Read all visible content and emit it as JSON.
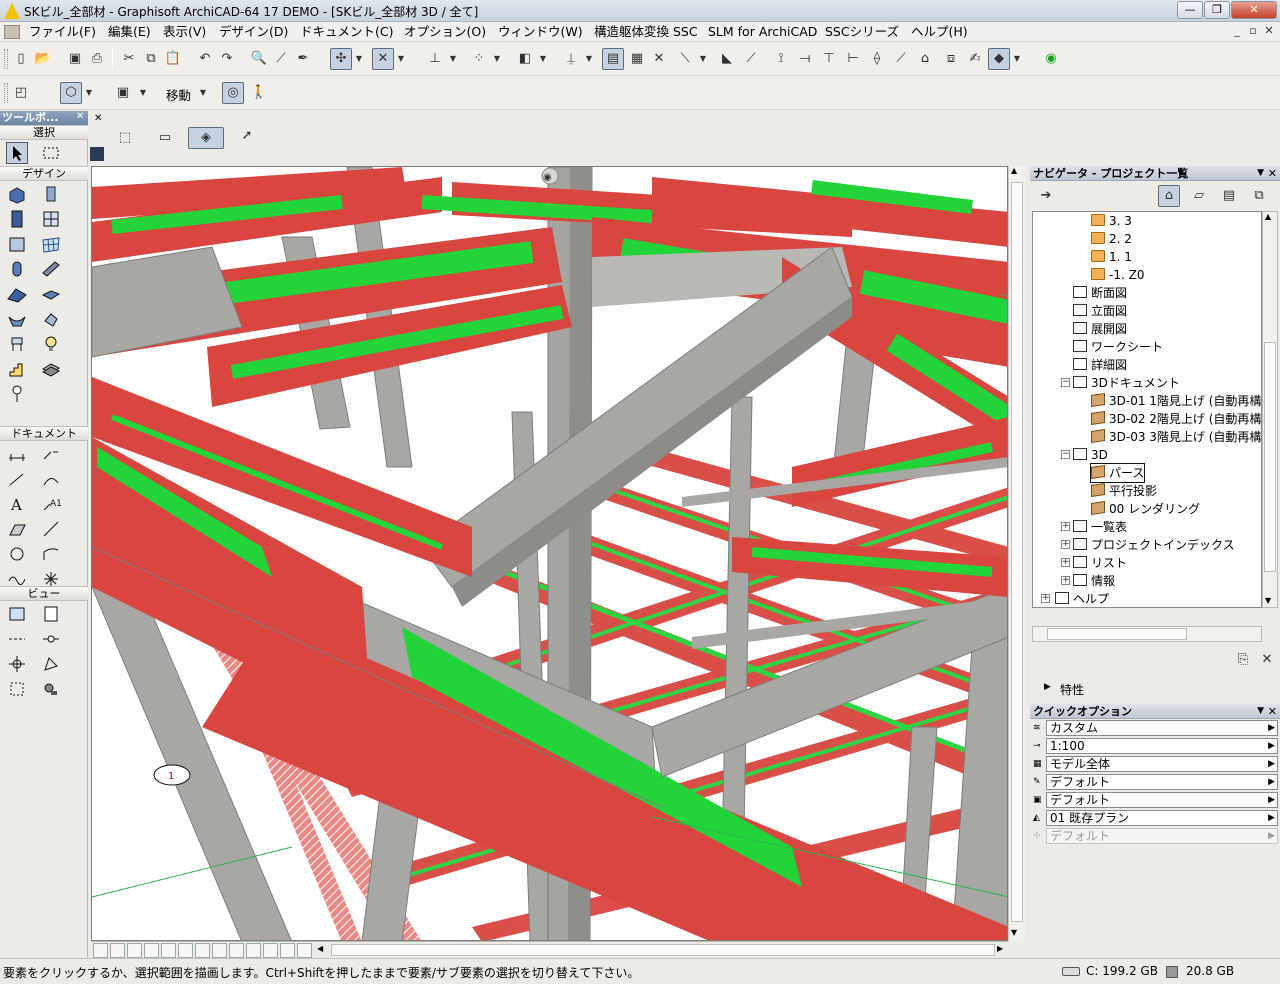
{
  "window": {
    "title": "SKビル_全部材 - Graphisoft ArchiCAD-64 17 DEMO - [SKビル_全部材 3D / 全て]",
    "minimize": "—",
    "maximize": "❐",
    "close": "✕"
  },
  "menu": {
    "items": [
      "ファイル(F)",
      "編集(E)",
      "表示(V)",
      "デザイン(D)",
      "ドキュメント(C)",
      "オプション(O)",
      "ウィンドウ(W)",
      "構造躯体変換 SSC",
      "SLM for ArchiCAD",
      "SSCシリーズ",
      "ヘルプ(H)"
    ]
  },
  "toolbar2": {
    "move_label": "移動"
  },
  "toolbox": {
    "title": "ツールボ...",
    "sections": {
      "select": "選択",
      "design": "デザイン",
      "document": "ドキュメント",
      "view": "ビュー"
    }
  },
  "navigator": {
    "title": "ナビゲータ - プロジェクト一覧",
    "tree": [
      {
        "label": "3. 3",
        "icon": "story-icon"
      },
      {
        "label": "2. 2",
        "icon": "story-icon"
      },
      {
        "label": "1. 1",
        "icon": "story-icon"
      },
      {
        "label": "-1. Z0",
        "icon": "story-icon"
      },
      {
        "label": "断面図",
        "icon": "section-icon"
      },
      {
        "label": "立面図",
        "icon": "elevation-icon"
      },
      {
        "label": "展開図",
        "icon": "interior-elevation-icon"
      },
      {
        "label": "ワークシート",
        "icon": "worksheet-icon"
      },
      {
        "label": "詳細図",
        "icon": "detail-icon"
      },
      {
        "label": "3Dドキュメント",
        "icon": "3d-document-icon"
      },
      {
        "label": "3D-01 1階見上げ (自動再構",
        "icon": "3d-doc-item-icon"
      },
      {
        "label": "3D-02 2階見上げ (自動再構",
        "icon": "3d-doc-item-icon"
      },
      {
        "label": "3D-03 3階見上げ (自動再構",
        "icon": "3d-doc-item-icon"
      },
      {
        "label": "3D",
        "icon": "3d-icon"
      },
      {
        "label": "パース",
        "icon": "camera-icon"
      },
      {
        "label": "平行投影",
        "icon": "axon-icon"
      },
      {
        "label": "00 レンダリング",
        "icon": "render-icon"
      },
      {
        "label": "一覧表",
        "icon": "schedule-icon"
      },
      {
        "label": "プロジェクトインデックス",
        "icon": "index-icon"
      },
      {
        "label": "リスト",
        "icon": "list-icon"
      },
      {
        "label": "情報",
        "icon": "info-icon"
      },
      {
        "label": "ヘルプ",
        "icon": "help-icon"
      }
    ],
    "properties_label": "特性"
  },
  "quick_options": {
    "title": "クイックオプション",
    "rows": [
      "カスタム",
      "1:100",
      "モデル全体",
      "デフォルト",
      "デフォルト",
      "01 既存プラン",
      "デフォルト"
    ]
  },
  "status": {
    "message": "要素をクリックするか、選択範囲を描画します。Ctrl+Shiftを押したままで要素/サブ要素の選択を切り替えて下さい。",
    "disk_c": "C: 199.2 GB",
    "disk_other": "20.8 GB"
  },
  "colors": {
    "beam_red": "#d9453f",
    "beam_green": "#22d33a",
    "concrete": "#a8a7a3",
    "panel_head": "#6c86a6"
  }
}
